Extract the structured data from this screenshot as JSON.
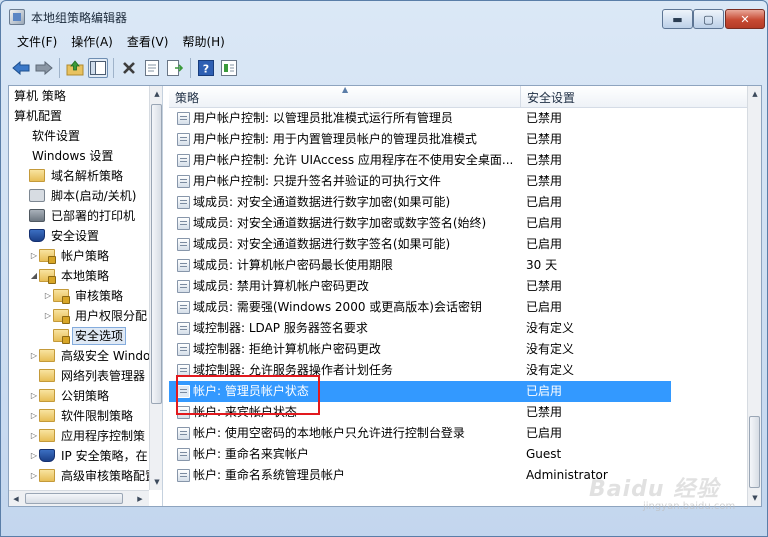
{
  "window": {
    "title": "本地组策略编辑器",
    "minimize_glyph": "▬",
    "maximize_glyph": "▢",
    "close_glyph": "✕"
  },
  "menu": [
    "文件(F)",
    "操作(A)",
    "查看(V)",
    "帮助(H)"
  ],
  "toolbar_icons": [
    "back-arrow-icon",
    "forward-arrow-icon",
    "up-folder-icon",
    "show-hide-tree-icon",
    "delete-icon",
    "properties-icon",
    "export-list-icon",
    "help-icon",
    "details-view-icon"
  ],
  "tree": {
    "items": [
      {
        "label": "算机 策略",
        "depth": 0,
        "icon": "none",
        "twisty": ""
      },
      {
        "label": "算机配置",
        "depth": 0,
        "icon": "none",
        "twisty": ""
      },
      {
        "label": "软件设置",
        "depth": 1,
        "icon": "none",
        "twisty": ""
      },
      {
        "label": "Windows 设置",
        "depth": 1,
        "icon": "none",
        "twisty": ""
      },
      {
        "label": "域名解析策略",
        "depth": 1,
        "icon": "folder",
        "twisty": ""
      },
      {
        "label": "脚本(启动/关机)",
        "depth": 1,
        "icon": "gear",
        "twisty": ""
      },
      {
        "label": "已部署的打印机",
        "depth": 1,
        "icon": "printer",
        "twisty": ""
      },
      {
        "label": "安全设置",
        "depth": 1,
        "icon": "shield",
        "twisty": ""
      },
      {
        "label": "帐户策略",
        "depth": 2,
        "icon": "folder-lock",
        "twisty": "▷"
      },
      {
        "label": "本地策略",
        "depth": 2,
        "icon": "folder-lock",
        "twisty": "◢"
      },
      {
        "label": "审核策略",
        "depth": 3,
        "icon": "folder-lock",
        "twisty": "▷"
      },
      {
        "label": "用户权限分配",
        "depth": 3,
        "icon": "folder-lock",
        "twisty": "▷"
      },
      {
        "label": "安全选项",
        "depth": 3,
        "icon": "folder-lock",
        "twisty": "",
        "selected": true
      },
      {
        "label": "高级安全 Windo",
        "depth": 2,
        "icon": "folder",
        "twisty": "▷"
      },
      {
        "label": "网络列表管理器",
        "depth": 2,
        "icon": "folder",
        "twisty": ""
      },
      {
        "label": "公钥策略",
        "depth": 2,
        "icon": "folder",
        "twisty": "▷"
      },
      {
        "label": "软件限制策略",
        "depth": 2,
        "icon": "folder",
        "twisty": "▷"
      },
      {
        "label": "应用程序控制策",
        "depth": 2,
        "icon": "folder",
        "twisty": "▷"
      },
      {
        "label": "IP 安全策略，在",
        "depth": 2,
        "icon": "shield",
        "twisty": "▷"
      },
      {
        "label": "高级审核策略配置",
        "depth": 2,
        "icon": "folder",
        "twisty": "▷"
      }
    ]
  },
  "list": {
    "columns": {
      "policy": "策略",
      "setting": "安全设置"
    },
    "rows": [
      {
        "policy": "用户帐户控制: 以管理员批准模式运行所有管理员",
        "setting": "已禁用"
      },
      {
        "policy": "用户帐户控制: 用于内置管理员帐户的管理员批准模式",
        "setting": "已禁用"
      },
      {
        "policy": "用户帐户控制: 允许 UIAccess 应用程序在不使用安全桌面...",
        "setting": "已禁用"
      },
      {
        "policy": "用户帐户控制: 只提升签名并验证的可执行文件",
        "setting": "已禁用"
      },
      {
        "policy": "域成员: 对安全通道数据进行数字加密(如果可能)",
        "setting": "已启用"
      },
      {
        "policy": "域成员: 对安全通道数据进行数字加密或数字签名(始终)",
        "setting": "已启用"
      },
      {
        "policy": "域成员: 对安全通道数据进行数字签名(如果可能)",
        "setting": "已启用"
      },
      {
        "policy": "域成员: 计算机帐户密码最长使用期限",
        "setting": "30 天"
      },
      {
        "policy": "域成员: 禁用计算机帐户密码更改",
        "setting": "已禁用"
      },
      {
        "policy": "域成员: 需要强(Windows 2000 或更高版本)会话密钥",
        "setting": "已启用"
      },
      {
        "policy": "域控制器: LDAP 服务器签名要求",
        "setting": "没有定义"
      },
      {
        "policy": "域控制器: 拒绝计算机帐户密码更改",
        "setting": "没有定义"
      },
      {
        "policy": "域控制器: 允许服务器操作者计划任务",
        "setting": "没有定义"
      },
      {
        "policy": "帐户: 管理员帐户状态",
        "setting": "已启用",
        "selected": true
      },
      {
        "policy": "帐户: 来宾帐户状态",
        "setting": "已禁用"
      },
      {
        "policy": "帐户: 使用空密码的本地帐户只允许进行控制台登录",
        "setting": "已启用"
      },
      {
        "policy": "帐户: 重命名来宾帐户",
        "setting": "Guest"
      },
      {
        "policy": "帐户: 重命名系统管理员帐户",
        "setting": "Administrator"
      }
    ]
  },
  "watermark": {
    "main": "Baidu 经验",
    "sub": "jingyan.baidu.com"
  },
  "colors": {
    "selection": "#3399ff",
    "highlight_box": "#e2191e",
    "frame": "#c3d6ee"
  }
}
